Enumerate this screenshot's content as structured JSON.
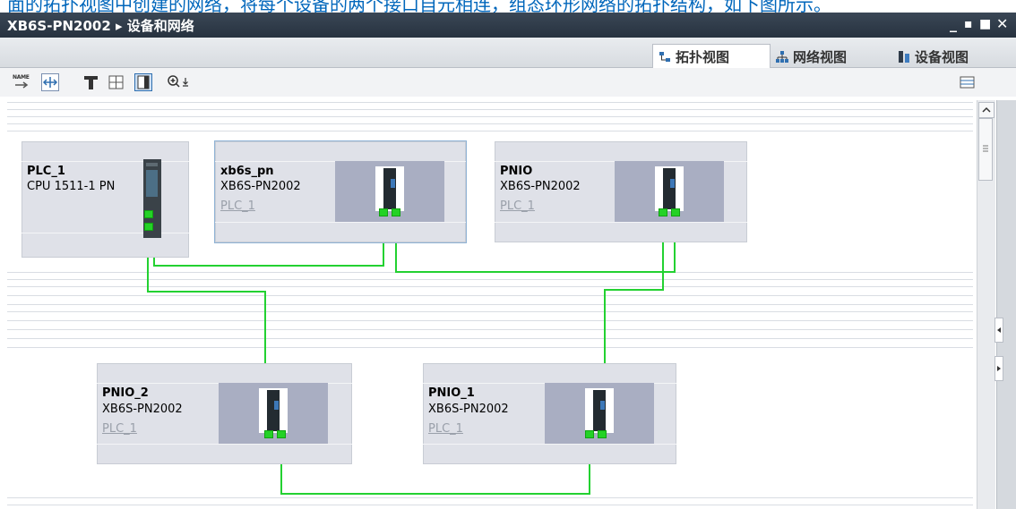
{
  "caption": "面的拓扑视图中创建的网络，将每个设备的两个接口自元相连，组态环形网络的拓扑结构，如下图所示。",
  "window": {
    "title": "XB6S-PN2002 ▸ 设备和网络",
    "controls": [
      "_",
      "▪",
      "■",
      "✕"
    ]
  },
  "view_tabs": [
    {
      "label": "拓扑视图",
      "icon": "topology-view-icon",
      "active": true
    },
    {
      "label": "网络视图",
      "icon": "network-view-icon",
      "active": false
    },
    {
      "label": "设备视图",
      "icon": "device-view-icon",
      "active": false
    }
  ],
  "toolbar": {
    "name_icon_text": "NAME",
    "zoom_icon": "zoom-in-icon"
  },
  "colors": {
    "link": "#23d131",
    "device_bg": "#dfe1e8",
    "image_bg": "#a9aec2",
    "titlebar": "#2f3b49"
  },
  "devices": [
    {
      "name": "PLC_1",
      "type": "CPU 1511-1 PN",
      "plc": ""
    },
    {
      "name": "xb6s_pn",
      "type": "XB6S-PN2002",
      "plc": "PLC_1"
    },
    {
      "name": "PNIO",
      "type": "XB6S-PN2002",
      "plc": "PLC_1"
    },
    {
      "name": "PNIO_2",
      "type": "XB6S-PN2002",
      "plc": "PLC_1"
    },
    {
      "name": "PNIO_1",
      "type": "XB6S-PN2002",
      "plc": "PLC_1"
    }
  ]
}
